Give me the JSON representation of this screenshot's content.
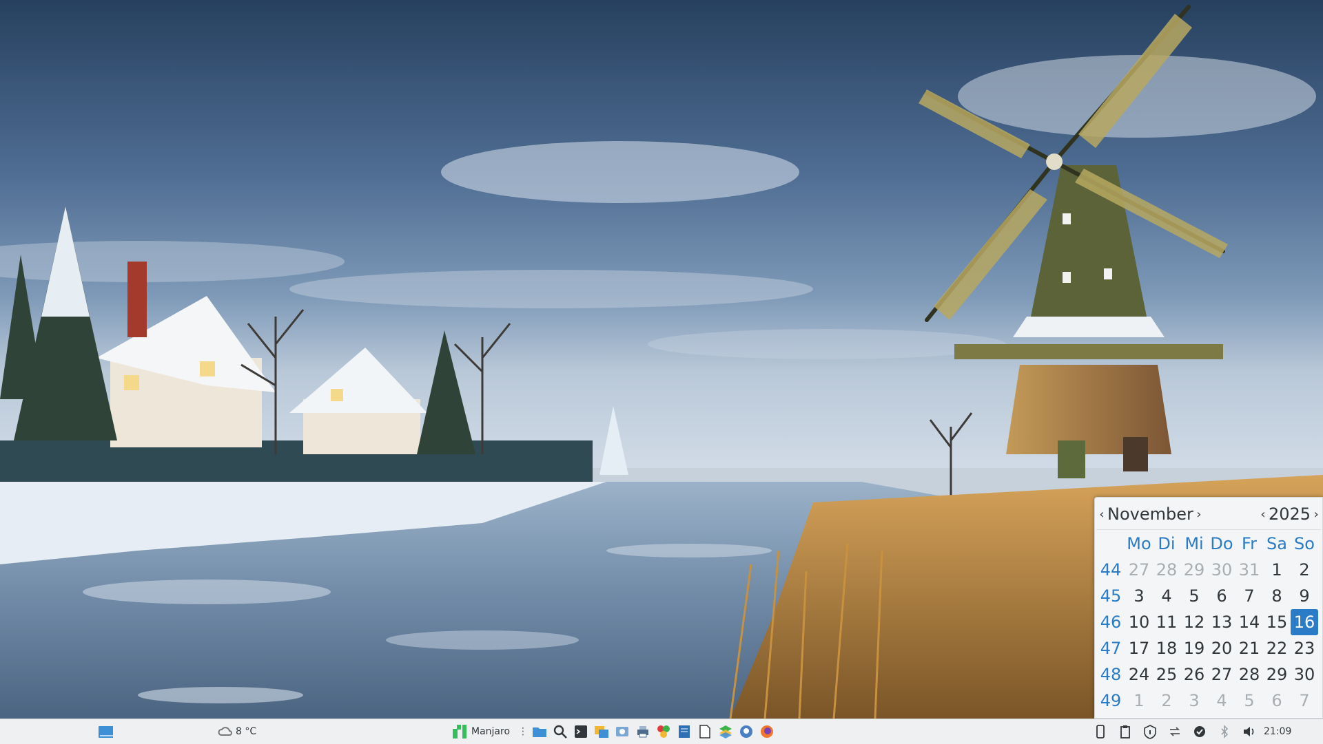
{
  "calendar": {
    "month": "November",
    "year": "2025",
    "weekday_headers": [
      "Mo",
      "Di",
      "Mi",
      "Do",
      "Fr",
      "Sa",
      "So"
    ],
    "weeks": [
      {
        "week": "44",
        "days": [
          {
            "d": "27",
            "other": true
          },
          {
            "d": "28",
            "other": true
          },
          {
            "d": "29",
            "other": true
          },
          {
            "d": "30",
            "other": true
          },
          {
            "d": "31",
            "other": true
          },
          {
            "d": "1"
          },
          {
            "d": "2"
          }
        ]
      },
      {
        "week": "45",
        "days": [
          {
            "d": "3"
          },
          {
            "d": "4"
          },
          {
            "d": "5"
          },
          {
            "d": "6"
          },
          {
            "d": "7"
          },
          {
            "d": "8"
          },
          {
            "d": "9"
          }
        ]
      },
      {
        "week": "46",
        "days": [
          {
            "d": "10"
          },
          {
            "d": "11"
          },
          {
            "d": "12"
          },
          {
            "d": "13"
          },
          {
            "d": "14"
          },
          {
            "d": "15"
          },
          {
            "d": "16",
            "today": true
          }
        ]
      },
      {
        "week": "47",
        "days": [
          {
            "d": "17"
          },
          {
            "d": "18"
          },
          {
            "d": "19"
          },
          {
            "d": "20"
          },
          {
            "d": "21"
          },
          {
            "d": "22"
          },
          {
            "d": "23"
          }
        ]
      },
      {
        "week": "48",
        "days": [
          {
            "d": "24"
          },
          {
            "d": "25"
          },
          {
            "d": "26"
          },
          {
            "d": "27"
          },
          {
            "d": "28"
          },
          {
            "d": "29"
          },
          {
            "d": "30"
          }
        ]
      },
      {
        "week": "49",
        "days": [
          {
            "d": "1",
            "other": true
          },
          {
            "d": "2",
            "other": true
          },
          {
            "d": "3",
            "other": true
          },
          {
            "d": "4",
            "other": true
          },
          {
            "d": "5",
            "other": true
          },
          {
            "d": "6",
            "other": true
          },
          {
            "d": "7",
            "other": true
          }
        ]
      }
    ],
    "accent_color": "#2a7cc7"
  },
  "taskbar": {
    "weather_temp": "8 °C",
    "launcher_label": "Manjaro",
    "clock": "21:09",
    "quicklaunch_icons": [
      "file-manager-icon",
      "search-icon",
      "terminal-icon",
      "file-explorer-icon",
      "screenshot-icon",
      "printer-icon",
      "color-picker-icon",
      "text-editor-icon",
      "document-icon",
      "layers-icon",
      "github-icon",
      "firefox-icon"
    ],
    "tray_icons": [
      "phone-icon",
      "clipboard-icon",
      "info-icon",
      "network-sync-icon",
      "update-check-icon",
      "bluetooth-icon",
      "volume-icon"
    ]
  }
}
